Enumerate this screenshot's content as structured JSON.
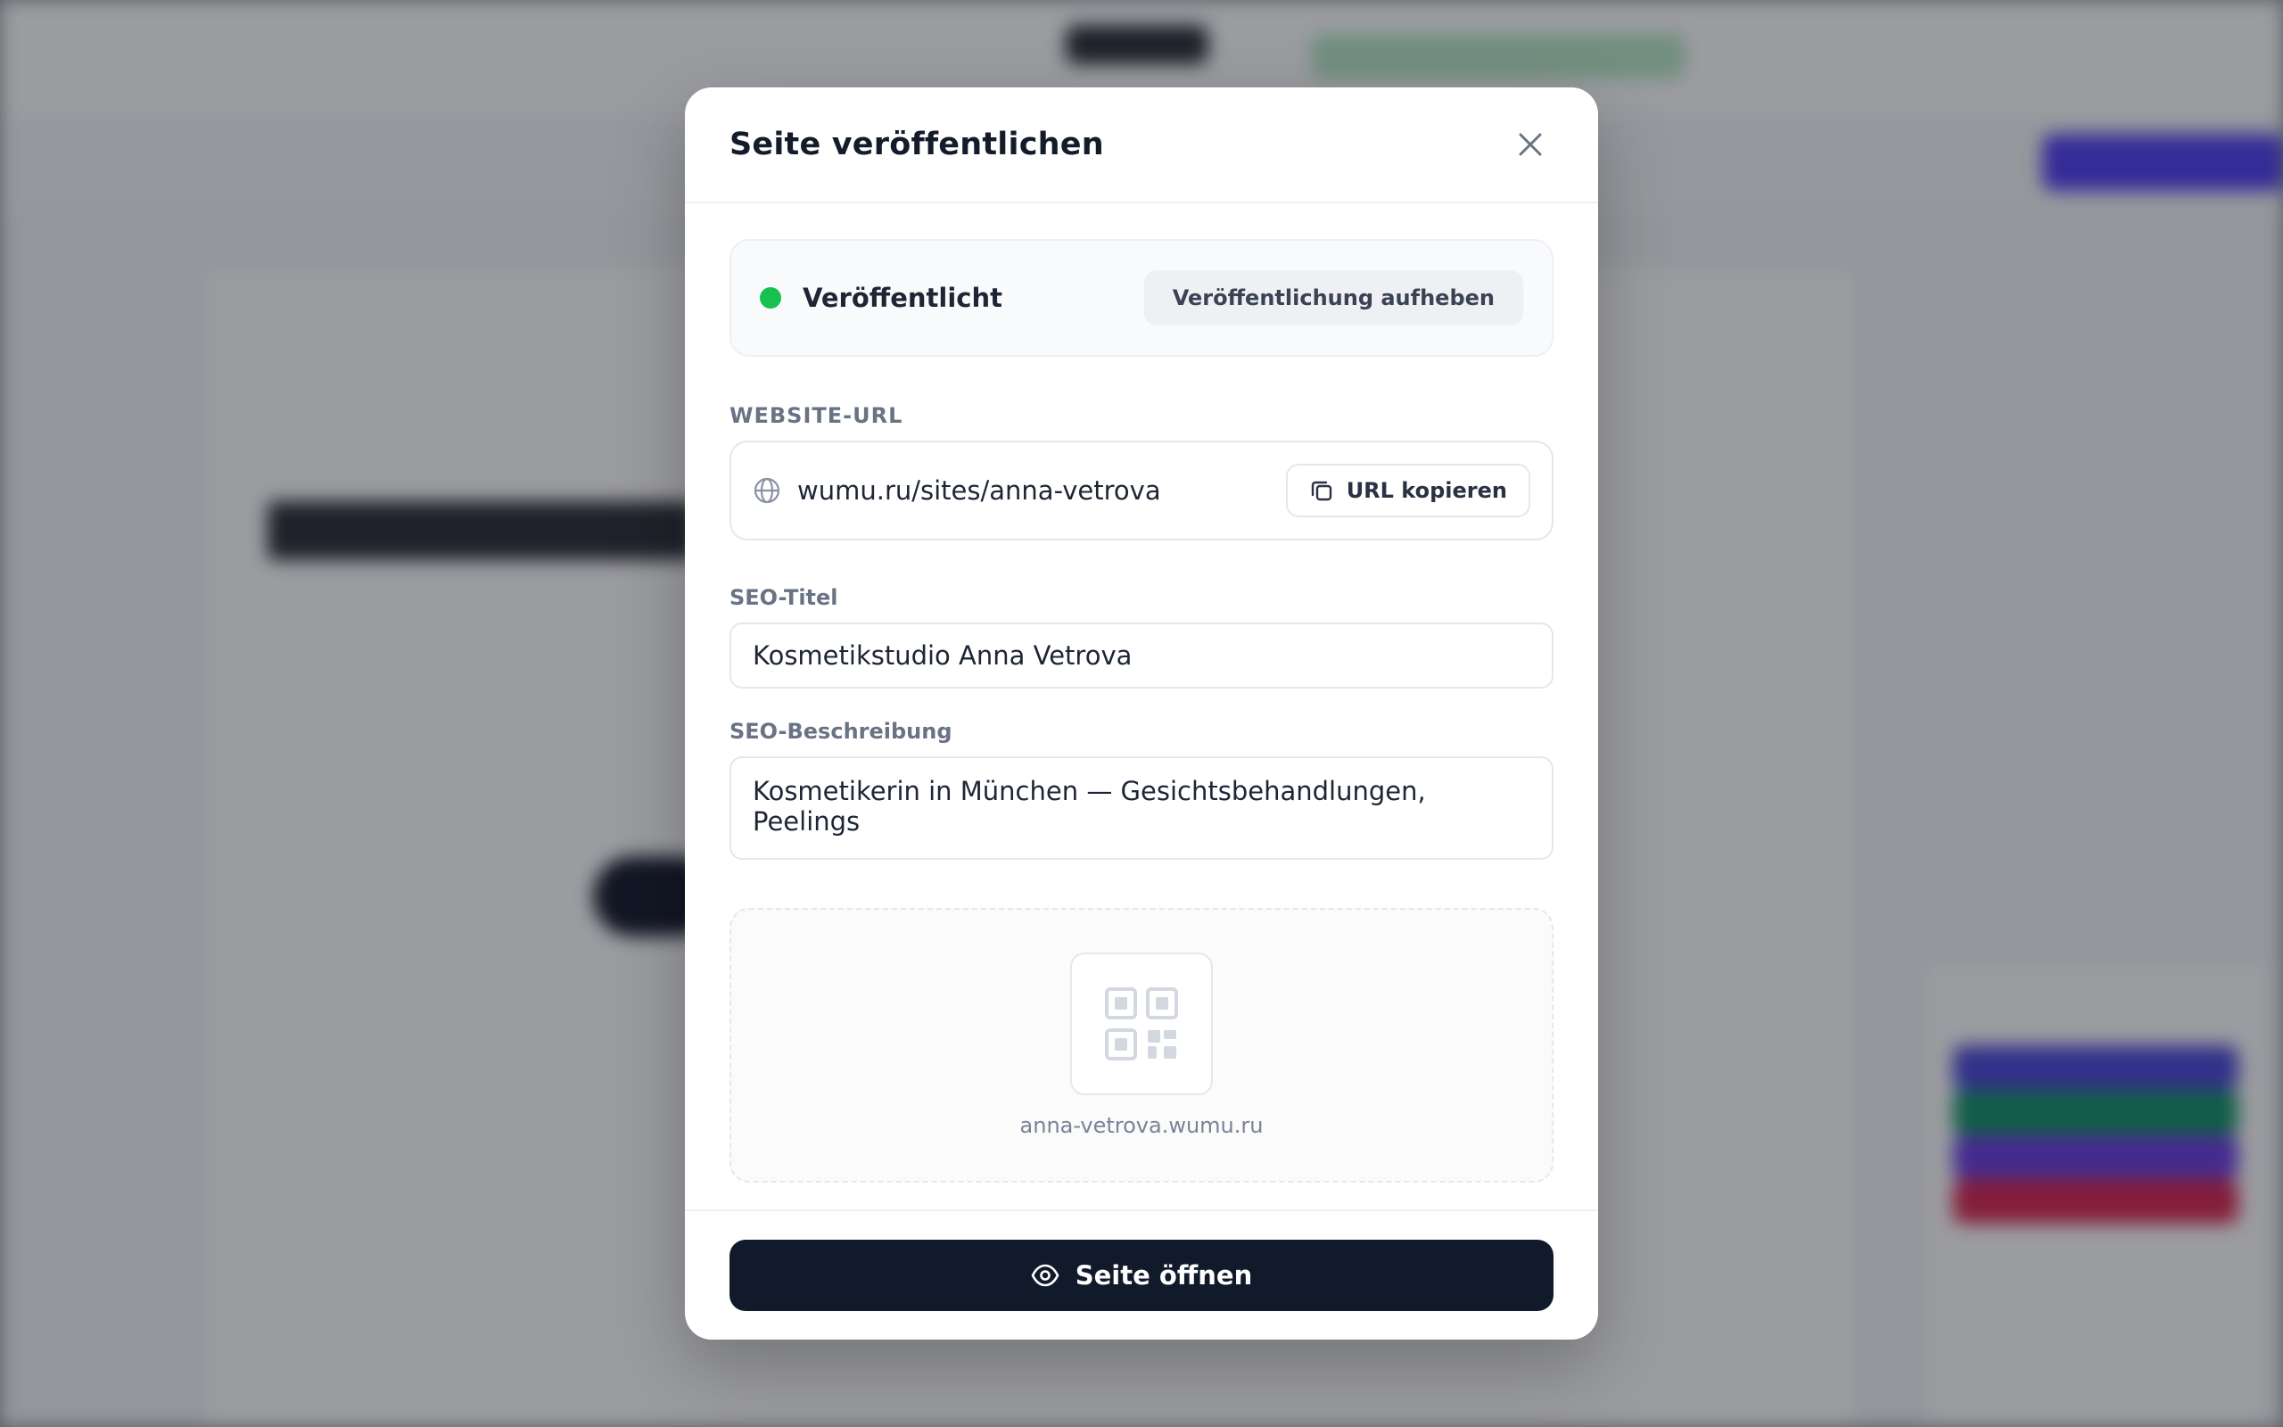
{
  "modal": {
    "title": "Seite veröffentlichen",
    "status": {
      "label": "Veröffentlicht",
      "color": "#16c150",
      "unpublish_button": "Veröffentlichung aufheben"
    },
    "website_url": {
      "label": "WEBSITE-URL",
      "value": "wumu.ru/sites/anna-vetrova",
      "copy_button": "URL kopieren",
      "icon": "globe-icon"
    },
    "seo_title": {
      "label": "SEO-Titel",
      "value": "Kosmetikstudio Anna Vetrova"
    },
    "seo_description": {
      "label": "SEO-Beschreibung",
      "value": "Kosmetikerin in München — Gesichtsbehandlungen, Peelings"
    },
    "qr": {
      "icon": "qr-code-icon",
      "caption": "anna-vetrova.wumu.ru"
    },
    "open_button": {
      "label": "Seite öffnen",
      "icon": "eye-icon",
      "color": "#111a2b"
    }
  }
}
